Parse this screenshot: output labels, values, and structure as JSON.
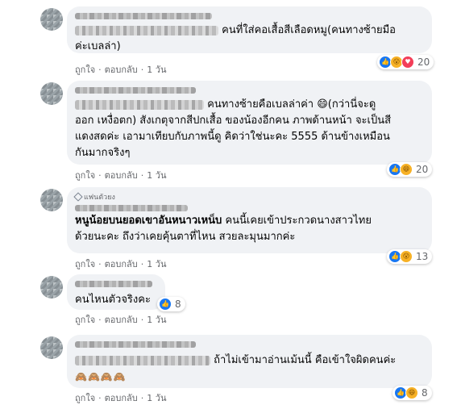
{
  "comments": [
    {
      "text_after_blur": "คนที่ใส่คอเสื้อสีเลือดหมู(คนทางซ้ายมือ",
      "text_line2": "ค่ะเบลล่า)",
      "like_label": "ถูกใจ",
      "reply_label": "ตอบกลับ",
      "time": "1 วัน",
      "reaction_count": "20",
      "reaction_icons": [
        "like-icon",
        "wow-icon",
        "love-icon"
      ]
    },
    {
      "text_line1": "คนทางซ้ายคือเบลล่าค่า 😄(กว่านี่จะดู",
      "text_line2": "ออก เหงื่อตก) สังเกตุจากสีปกเสื้อ ของน้องอีกคน ภาพด้านหน้า จะเป็นสี",
      "text_line3": "แดงสดค่ะ เอามาเทียบกับภาพนี้ดู คิดว่าใช่นะคะ 5555 ด้านข้างเหมือน",
      "text_line4": "กันมากจริงๆ",
      "like_label": "ถูกใจ",
      "reply_label": "ตอบกลับ",
      "time": "1 วัน",
      "reaction_count": "20",
      "reaction_icons": [
        "like-icon",
        "haha-icon"
      ]
    },
    {
      "badge": "แฟนตัวยง",
      "author_bold": "หนูน้อยบนยอดเขาอันหนาวเหน็บ",
      "text_line1": "คนนี้เคยเข้าประกวดนางสาวไทย",
      "text_line2": "ด้วยนะคะ ถึงว่าเคยคุ้นตาที่ไหน สวยละมุนมากค่ะ",
      "like_label": "ถูกใจ",
      "reply_label": "ตอบกลับ",
      "time": "1 วัน",
      "reaction_count": "13",
      "reaction_icons": [
        "like-icon",
        "wow-icon"
      ]
    },
    {
      "text_line1": "คนไหนตัวจริงคะ",
      "like_label": "ถูกใจ",
      "reply_label": "ตอบกลับ",
      "time": "1 วัน",
      "reaction_count": "8",
      "reaction_icons": [
        "like-icon"
      ]
    },
    {
      "text_after_blur": "ถ้าไม่เข้ามาอ่านเม้นนี้ คือเข้าใจผิดคนค่ะ",
      "emoji_line": "🙈🙈🙈🙈",
      "like_label": "ถูกใจ",
      "reply_label": "ตอบกลับ",
      "time": "1 วัน",
      "reaction_count": "8",
      "reaction_icons": [
        "like-icon",
        "haha-icon"
      ]
    }
  ],
  "colors": {
    "bubble": "#f0f2f5",
    "meta_text": "#65676b",
    "like": "#1877f2",
    "yellow": "#f7b125",
    "love": "#f33e58"
  }
}
